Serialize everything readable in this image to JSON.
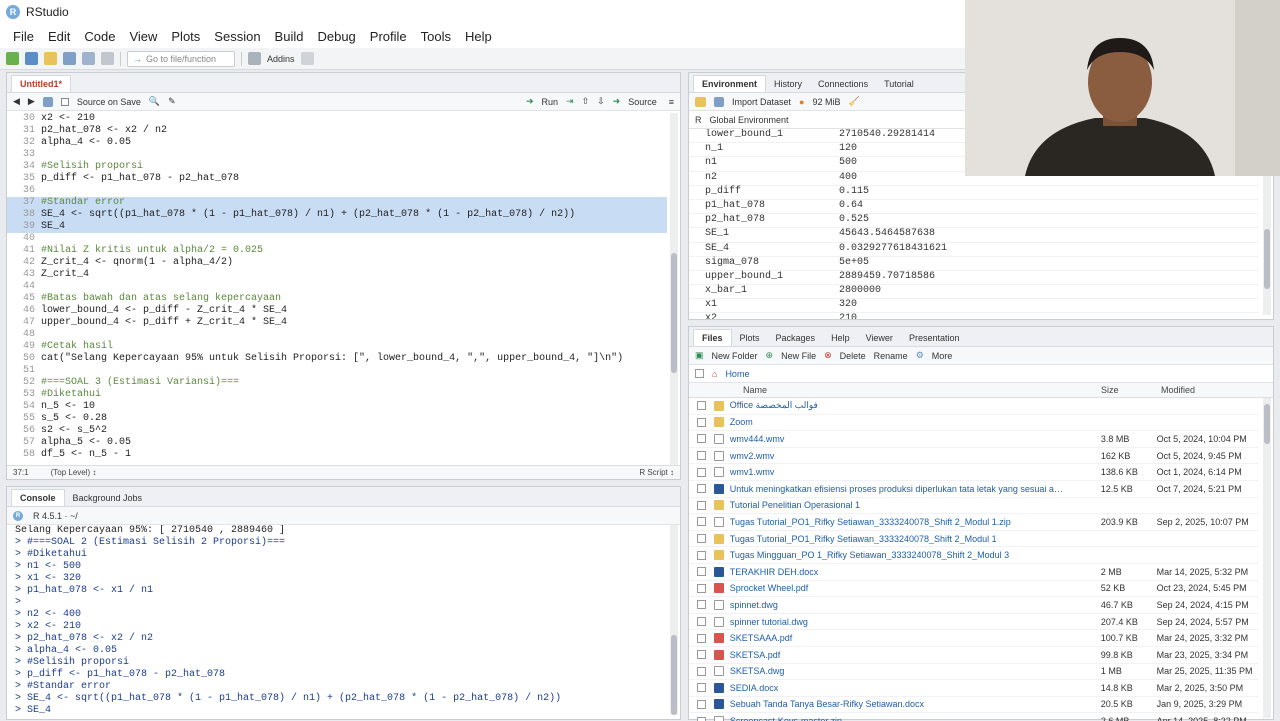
{
  "window": {
    "title": "RStudio",
    "logo_letter": "R"
  },
  "menu": [
    "File",
    "Edit",
    "Code",
    "View",
    "Plots",
    "Session",
    "Build",
    "Debug",
    "Profile",
    "Tools",
    "Help"
  ],
  "toolbar": {
    "goto_placeholder": "Go to file/function",
    "addins": "Addins"
  },
  "editor": {
    "tab": "Untitled1*",
    "source_on_save": "Source on Save",
    "run": "Run",
    "source": "Source",
    "status_pos": "37:1",
    "status_level": "(Top Level) ↕",
    "status_type": "R Script ↕",
    "lines": [
      {
        "n": "30",
        "t": "x2 <- 210",
        "s": false,
        "c": false
      },
      {
        "n": "31",
        "t": "p2_hat_078 <- x2 / n2",
        "s": false,
        "c": false
      },
      {
        "n": "32",
        "t": "alpha_4 <- 0.05",
        "s": false,
        "c": false
      },
      {
        "n": "33",
        "t": "",
        "s": false,
        "c": false
      },
      {
        "n": "34",
        "t": "#Selisih proporsi",
        "s": false,
        "c": true
      },
      {
        "n": "35",
        "t": "p_diff <- p1_hat_078 - p2_hat_078",
        "s": false,
        "c": false
      },
      {
        "n": "36",
        "t": "",
        "s": false,
        "c": false
      },
      {
        "n": "37",
        "t": "#Standar error",
        "s": true,
        "c": true
      },
      {
        "n": "38",
        "t": "SE_4 <- sqrt((p1_hat_078 * (1 - p1_hat_078) / n1) + (p2_hat_078 * (1 - p2_hat_078) / n2))",
        "s": true,
        "c": false
      },
      {
        "n": "39",
        "t": "SE_4",
        "s": true,
        "c": false
      },
      {
        "n": "40",
        "t": "",
        "s": false,
        "c": false
      },
      {
        "n": "41",
        "t": "#Nilai Z kritis untuk alpha/2 = 0.025",
        "s": false,
        "c": true
      },
      {
        "n": "42",
        "t": "Z_crit_4 <- qnorm(1 - alpha_4/2)",
        "s": false,
        "c": false
      },
      {
        "n": "43",
        "t": "Z_crit_4",
        "s": false,
        "c": false
      },
      {
        "n": "44",
        "t": "",
        "s": false,
        "c": false
      },
      {
        "n": "45",
        "t": "#Batas bawah dan atas selang kepercayaan",
        "s": false,
        "c": true
      },
      {
        "n": "46",
        "t": "lower_bound_4 <- p_diff - Z_crit_4 * SE_4",
        "s": false,
        "c": false
      },
      {
        "n": "47",
        "t": "upper_bound_4 <- p_diff + Z_crit_4 * SE_4",
        "s": false,
        "c": false
      },
      {
        "n": "48",
        "t": "",
        "s": false,
        "c": false
      },
      {
        "n": "49",
        "t": "#Cetak hasil",
        "s": false,
        "c": true
      },
      {
        "n": "50",
        "t": "cat(\"Selang Kepercayaan 95% untuk Selisih Proporsi: [\", lower_bound_4, \",\", upper_bound_4, \"]\\n\")",
        "s": false,
        "c": false
      },
      {
        "n": "51",
        "t": "",
        "s": false,
        "c": false
      },
      {
        "n": "52",
        "t": "#===SOAL 3 (Estimasi Variansi)===",
        "s": false,
        "c": true
      },
      {
        "n": "53",
        "t": "#Diketahui",
        "s": false,
        "c": true
      },
      {
        "n": "54",
        "t": "n_5 <- 10",
        "s": false,
        "c": false
      },
      {
        "n": "55",
        "t": "s_5 <- 0.28",
        "s": false,
        "c": false
      },
      {
        "n": "56",
        "t": "s2 <- s_5^2",
        "s": false,
        "c": false
      },
      {
        "n": "57",
        "t": "alpha_5 <- 0.05",
        "s": false,
        "c": false
      },
      {
        "n": "58",
        "t": "df_5 <- n_5 - 1",
        "s": false,
        "c": false
      }
    ]
  },
  "console": {
    "tabs": [
      "Console",
      "Background Jobs"
    ],
    "version": "R 4.5.1 · ~/",
    "lines": [
      "Selang Kepercayaan 95%: [ 2710540 , 2889460 ]",
      "> #===SOAL 2 (Estimasi Selisih 2 Proporsi)===",
      "> #Diketahui",
      "> n1 <- 500",
      "> x1 <- 320",
      "> p1_hat_078 <- x1 / n1",
      ">",
      "> n2 <- 400",
      "> x2 <- 210",
      "> p2_hat_078 <- x2 / n2",
      "> alpha_4 <- 0.05",
      "> #Selisih proporsi",
      "> p_diff <- p1_hat_078 - p2_hat_078",
      "> #Standar error",
      "> SE_4 <- sqrt((p1_hat_078 * (1 - p1_hat_078) / n1) + (p2_hat_078 * (1 - p2_hat_078) / n2))",
      "> SE_4"
    ]
  },
  "environment": {
    "tabs": [
      "Environment",
      "History",
      "Connections",
      "Tutorial"
    ],
    "import_dataset": "Import Dataset",
    "memory": "92 MiB",
    "lang": "R",
    "scope": "Global Environment",
    "rows": [
      {
        "name": "lower_bound_1",
        "value": "2710540.29281414"
      },
      {
        "name": "n_1",
        "value": "120"
      },
      {
        "name": "n1",
        "value": "500"
      },
      {
        "name": "n2",
        "value": "400"
      },
      {
        "name": "p_diff",
        "value": "0.115"
      },
      {
        "name": "p1_hat_078",
        "value": "0.64"
      },
      {
        "name": "p2_hat_078",
        "value": "0.525"
      },
      {
        "name": "SE_1",
        "value": "45643.5464587638"
      },
      {
        "name": "SE_4",
        "value": "0.0329277618431621"
      },
      {
        "name": "sigma_078",
        "value": "5e+05"
      },
      {
        "name": "upper_bound_1",
        "value": "2889459.70718586"
      },
      {
        "name": "x_bar_1",
        "value": "2800000"
      },
      {
        "name": "x1",
        "value": "320"
      },
      {
        "name": "x2",
        "value": "210"
      }
    ]
  },
  "files": {
    "tabs": [
      "Files",
      "Plots",
      "Packages",
      "Help",
      "Viewer",
      "Presentation"
    ],
    "actions": {
      "new_folder": "New Folder",
      "new_file": "New File",
      "delete": "Delete",
      "rename": "Rename",
      "more": "More"
    },
    "path": "Home",
    "cols": {
      "name": "Name",
      "size": "Size",
      "modified": "Modified"
    },
    "rows": [
      {
        "name": "Office فوالب المخصصة",
        "size": "",
        "mod": "",
        "kind": "folder"
      },
      {
        "name": "Zoom",
        "size": "",
        "mod": "",
        "kind": "folder"
      },
      {
        "name": "wmv444.wmv",
        "size": "3.8 MB",
        "mod": "Oct 5, 2024, 10:04 PM",
        "kind": "file"
      },
      {
        "name": "wmv2.wmv",
        "size": "162 KB",
        "mod": "Oct 5, 2024, 9:45 PM",
        "kind": "file"
      },
      {
        "name": "wmv1.wmv",
        "size": "138.6 KB",
        "mod": "Oct 1, 2024, 6:14 PM",
        "kind": "file"
      },
      {
        "name": "Untuk meningkatkan efisiensi proses produksi diperlukan tata letak yang sesuai agar pe...",
        "size": "12.5 KB",
        "mod": "Oct 7, 2024, 5:21 PM",
        "kind": "word"
      },
      {
        "name": "Tutorial Penelitian Operasional 1",
        "size": "",
        "mod": "",
        "kind": "folder"
      },
      {
        "name": "Tugas Tutorial_PO1_Rifky Setiawan_3333240078_Shift 2_Modul 1.zip",
        "size": "203.9 KB",
        "mod": "Sep 2, 2025, 10:07 PM",
        "kind": "file"
      },
      {
        "name": "Tugas Tutorial_PO1_Rifky Setiawan_3333240078_Shift 2_Modul 1",
        "size": "",
        "mod": "",
        "kind": "folder"
      },
      {
        "name": "Tugas Mingguan_PO 1_Rifky Setiawan_3333240078_Shift 2_Modul 3",
        "size": "",
        "mod": "",
        "kind": "folder"
      },
      {
        "name": "TERAKHIR DEH.docx",
        "size": "2 MB",
        "mod": "Mar 14, 2025, 5:32 PM",
        "kind": "word"
      },
      {
        "name": "Sprocket Wheel.pdf",
        "size": "52 KB",
        "mod": "Oct 23, 2024, 5:45 PM",
        "kind": "pdf"
      },
      {
        "name": "spinnet.dwg",
        "size": "46.7 KB",
        "mod": "Sep 24, 2024, 4:15 PM",
        "kind": "file"
      },
      {
        "name": "spinner tutorial.dwg",
        "size": "207.4 KB",
        "mod": "Sep 24, 2024, 5:57 PM",
        "kind": "file"
      },
      {
        "name": "SKETSAAA.pdf",
        "size": "100.7 KB",
        "mod": "Mar 24, 2025, 3:32 PM",
        "kind": "pdf"
      },
      {
        "name": "SKETSA.pdf",
        "size": "99.8 KB",
        "mod": "Mar 23, 2025, 3:34 PM",
        "kind": "pdf"
      },
      {
        "name": "SKETSA.dwg",
        "size": "1 MB",
        "mod": "Mar 25, 2025, 11:35 PM",
        "kind": "file"
      },
      {
        "name": "SEDIA.docx",
        "size": "14.8 KB",
        "mod": "Mar 2, 2025, 3:50 PM",
        "kind": "word"
      },
      {
        "name": "Sebuah Tanda Tanya Besar-Rifky Setiawan.docx",
        "size": "20.5 KB",
        "mod": "Jan 9, 2025, 3:29 PM",
        "kind": "word"
      },
      {
        "name": "Screencast-Keys-master.zip",
        "size": "2.6 MB",
        "mod": "Apr 14, 2025, 8:22 PM",
        "kind": "file"
      }
    ]
  },
  "colors": {
    "folder": "#e8c25a",
    "word": "#2b5797",
    "pdf": "#d9534f",
    "file": "#ffffff",
    "selection": "#c8dcf4"
  }
}
